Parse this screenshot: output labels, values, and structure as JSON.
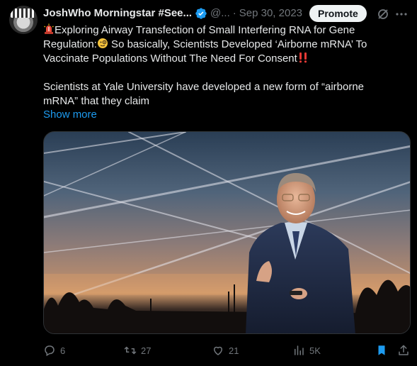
{
  "author": {
    "name": "JoshWho Morningstar #See...",
    "handle": "@...",
    "separator": "·",
    "date": "Sep 30, 2023",
    "verified_icon": "verified-badge-icon"
  },
  "header": {
    "promote_label": "Promote",
    "grok_icon": "grok-icon",
    "more_icon": "more-icon"
  },
  "tweet": {
    "line1": "Exploring Airway Transfection of Small Interfering RNA for Gene",
    "line2a": "Regulation:",
    "line2b": " So basically, Scientists Developed ‘Airborne mRNA’ To",
    "line3": "Vaccinate Populations Without The Need For Consent",
    "para2": "Scientists at Yale University have developed a new form of “airborne\nmRNA” that they claim",
    "show_more": "Show more"
  },
  "actions": {
    "replies": "6",
    "retweets": "27",
    "likes": "21",
    "views": "5K"
  },
  "colors": {
    "link": "#1d9bf0",
    "muted": "#71767b",
    "text": "#e7e9ea"
  }
}
